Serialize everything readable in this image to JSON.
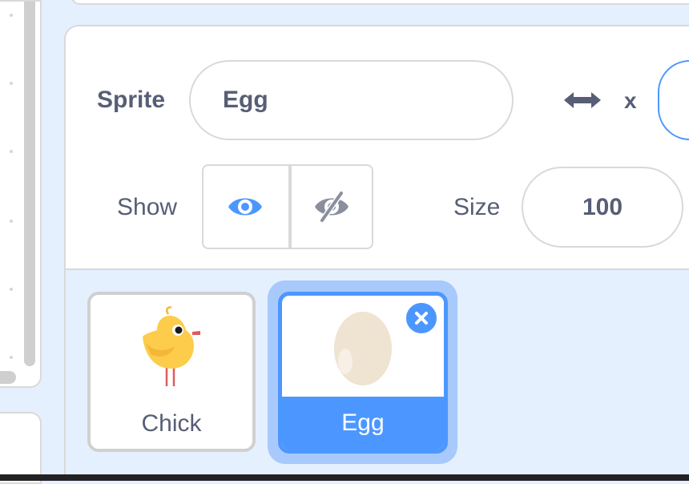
{
  "sprite_info": {
    "sprite_label": "Sprite",
    "sprite_name": "Egg",
    "x_label": "x",
    "show_label": "Show",
    "size_label": "Size",
    "size_value": "100",
    "visible": true
  },
  "sprites": [
    {
      "name": "Chick",
      "selected": false
    },
    {
      "name": "Egg",
      "selected": true
    }
  ],
  "colors": {
    "accent": "#4c97ff",
    "text": "#575e75",
    "panel_bg": "#e5f0ff",
    "border": "#d9d9d9"
  },
  "icons": {
    "direction": "horizontal-arrows-icon",
    "show": "eye-icon",
    "hide": "eye-slash-icon",
    "delete": "close-icon"
  }
}
